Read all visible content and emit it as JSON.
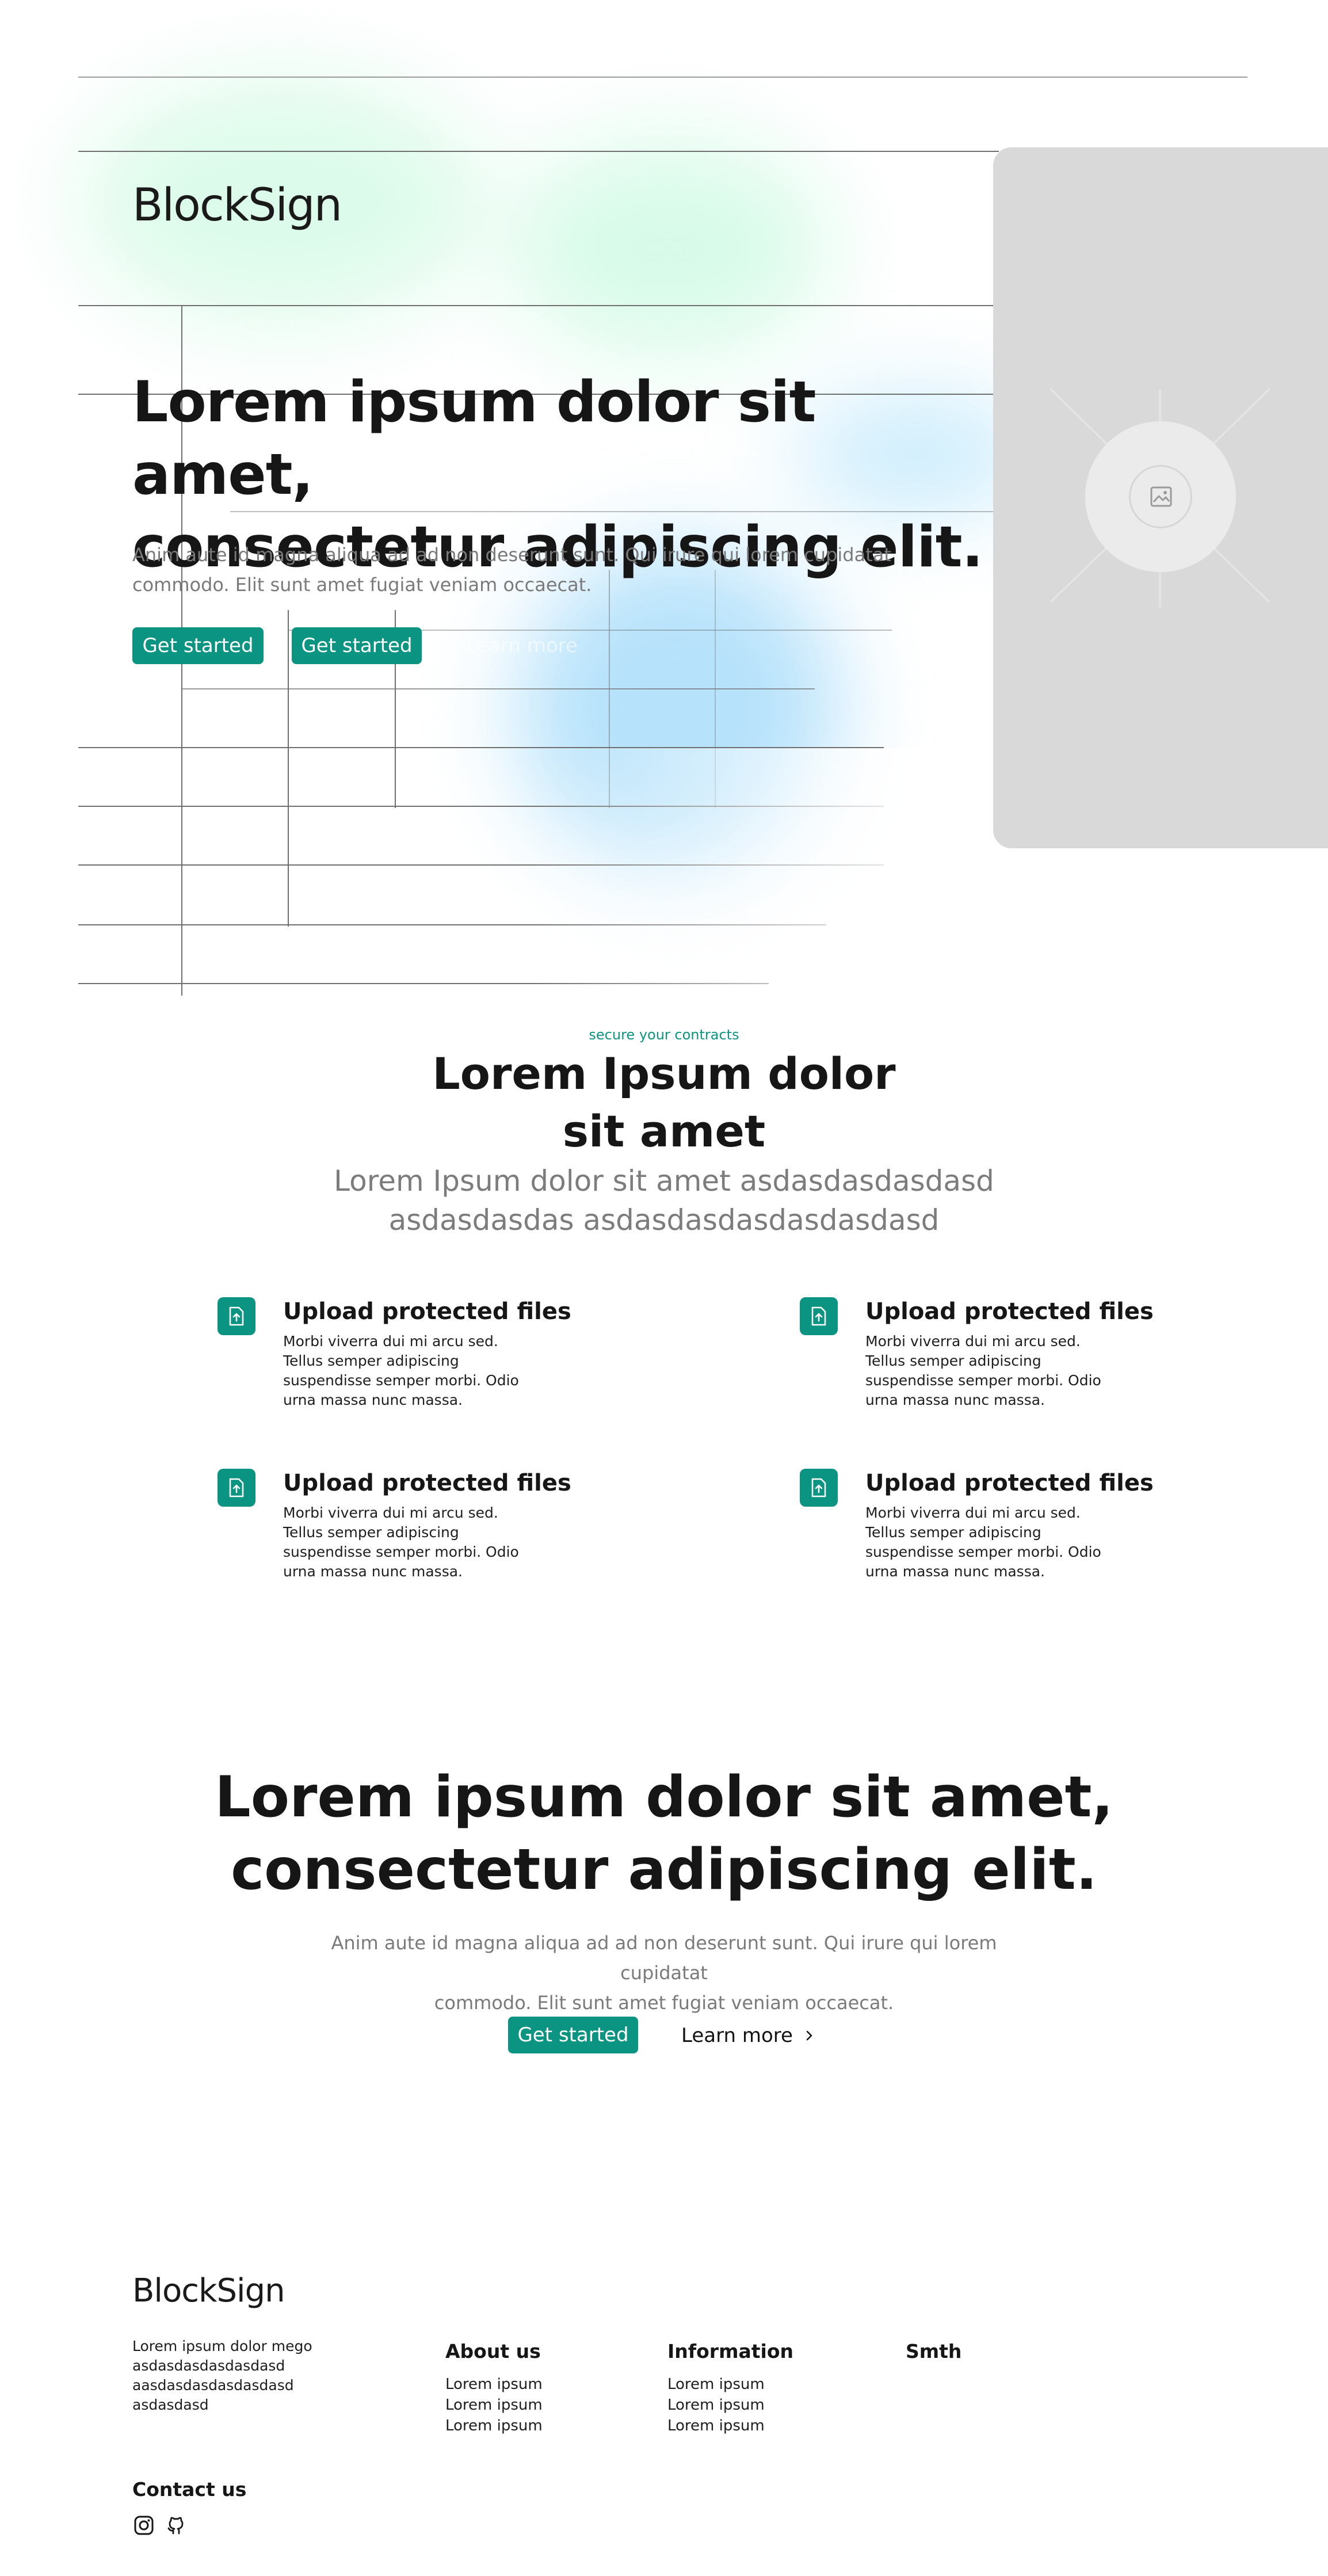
{
  "brand": {
    "name": "BlockSign"
  },
  "colors": {
    "accent": "#0c9482",
    "muted_text": "#7a7a7a",
    "media_bg": "#d9d9d9"
  },
  "hero": {
    "title_line1": "Lorem ipsum dolor sit amet,",
    "title_line2": "consectetur adipiscing elit.",
    "description_line1": "Anim aute id magna aliqua ad ad non deserunt sunt. Qui irure qui lorem cupidatat",
    "description_line2": "commodo. Elit sunt amet fugiat veniam occaecat.",
    "primary_button": "Get started",
    "secondary_button": "Get started",
    "tertiary_link": "Learn more",
    "media_icon": "image-placeholder-icon"
  },
  "features": {
    "eyebrow": "secure your contracts",
    "title_line1": "Lorem Ipsum dolor",
    "title_line2": "sit amet",
    "subtitle_line1": "Lorem Ipsum dolor sit amet asdasdasdasdasd",
    "subtitle_line2": "asdasdasdas asdasdasdasdasdasdasd",
    "items": [
      {
        "icon": "file-upload-icon",
        "title": "Upload protected files",
        "description": "Morbi viverra dui mi arcu sed. Tellus semper adipiscing suspendisse semper morbi. Odio urna massa nunc massa."
      },
      {
        "icon": "file-upload-icon",
        "title": "Upload protected files",
        "description": "Morbi viverra dui mi arcu sed. Tellus semper adipiscing suspendisse semper morbi. Odio urna massa nunc massa."
      },
      {
        "icon": "file-upload-icon",
        "title": "Upload protected files",
        "description": "Morbi viverra dui mi arcu sed. Tellus semper adipiscing suspendisse semper morbi. Odio urna massa nunc massa."
      },
      {
        "icon": "file-upload-icon",
        "title": "Upload protected files",
        "description": "Morbi viverra dui mi arcu sed. Tellus semper adipiscing suspendisse semper morbi. Odio urna massa nunc massa."
      }
    ]
  },
  "cta": {
    "title_line1": "Lorem ipsum dolor sit amet,",
    "title_line2": "consectetur adipiscing elit.",
    "description_line1": "Anim aute id magna aliqua ad ad non deserunt sunt. Qui irure qui lorem cupidatat",
    "description_line2": "commodo. Elit sunt amet fugiat veniam occaecat.",
    "primary_button": "Get started",
    "learn_more": "Learn more",
    "learn_more_icon": "chevron-right-icon"
  },
  "footer": {
    "logo": "BlockSign",
    "about_lines": [
      "Lorem ipsum dolor mego",
      "asdasdasdasdasdasd",
      "aasdasdasdasdasdasd",
      "asdasdasd"
    ],
    "columns": [
      {
        "title": "About us",
        "links": [
          "Lorem ipsum",
          "Lorem ipsum",
          "Lorem ipsum"
        ]
      },
      {
        "title": "Information",
        "links": [
          "Lorem ipsum",
          "Lorem ipsum",
          "Lorem ipsum"
        ]
      },
      {
        "title": "Smth",
        "links": []
      }
    ],
    "contact_title": "Contact us",
    "social_icons": [
      "instagram-icon",
      "github-icon"
    ]
  }
}
